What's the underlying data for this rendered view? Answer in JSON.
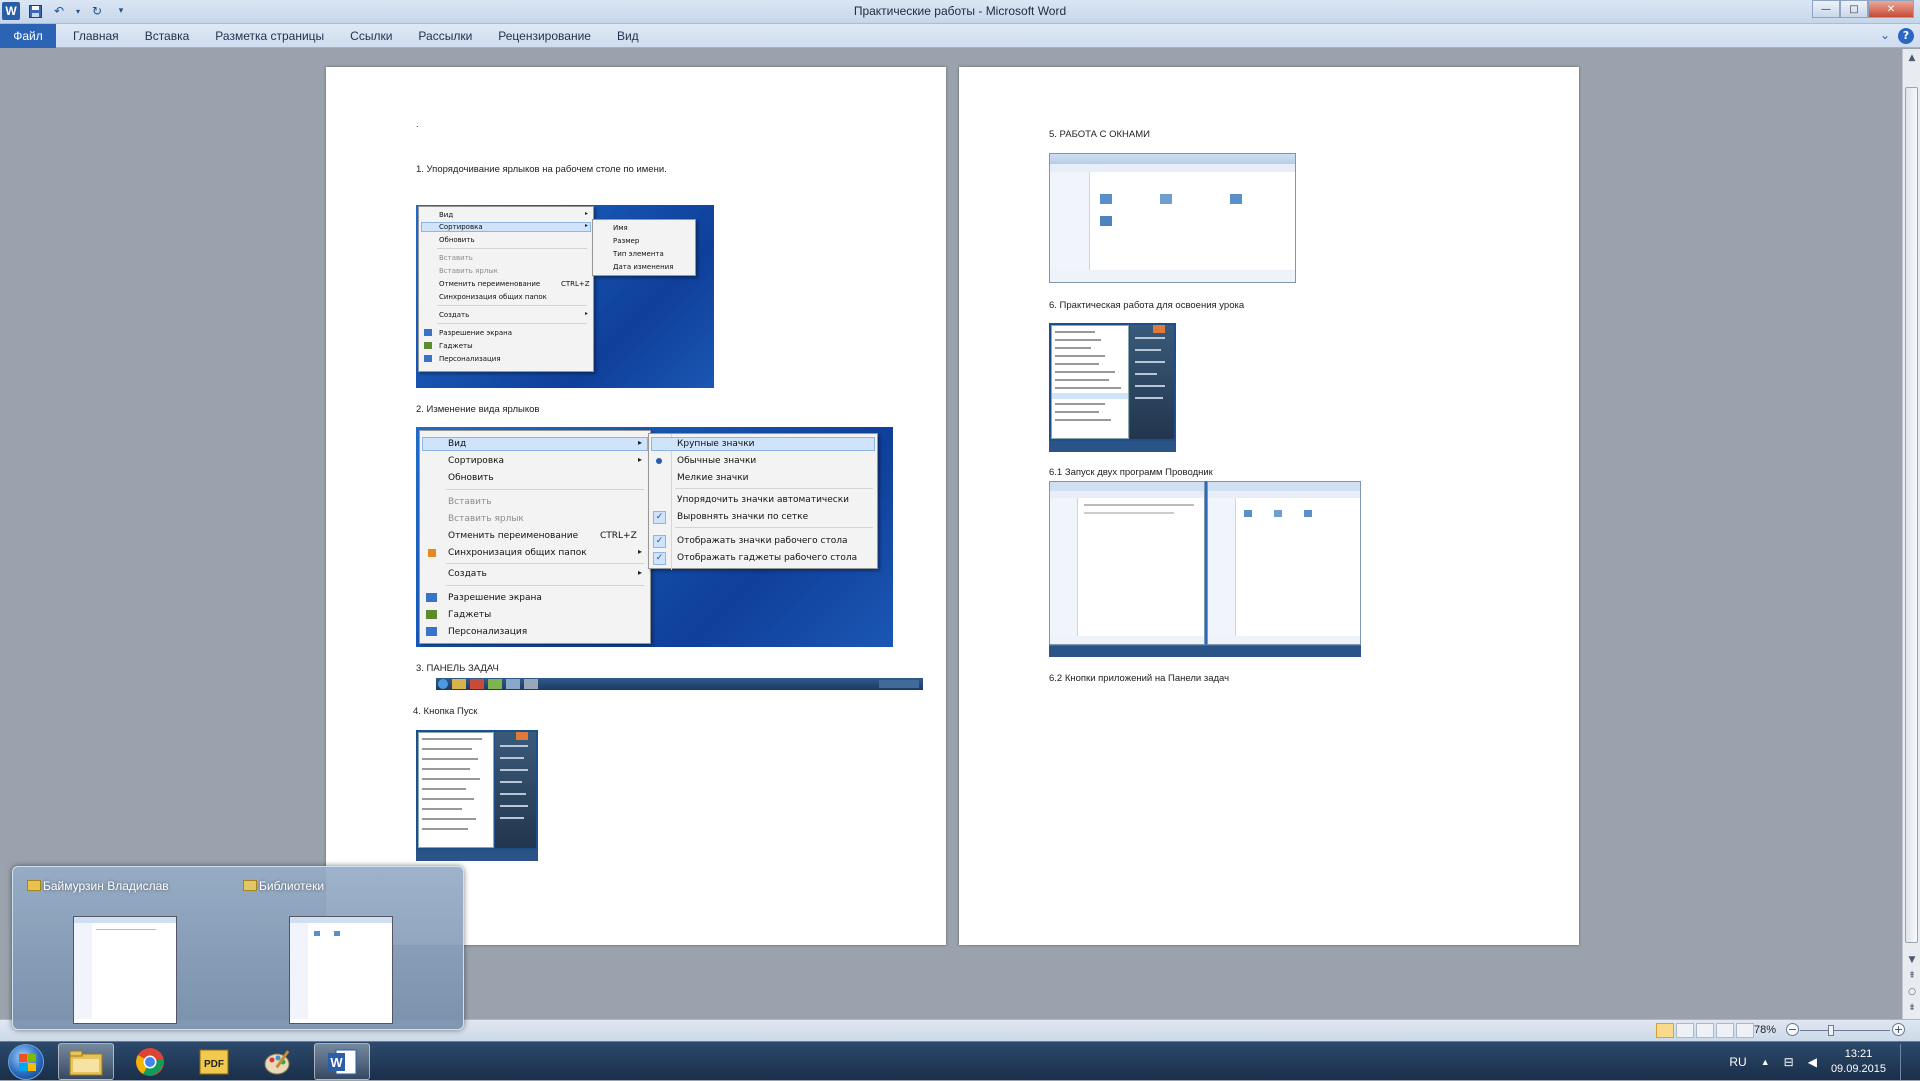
{
  "window": {
    "title": "Практические  работы  -  Microsoft Word",
    "controls": {
      "minimize": "—",
      "maximize": "□",
      "close": "✕"
    }
  },
  "ribbon": {
    "file_tab": "Файл",
    "tabs": [
      "Главная",
      "Вставка",
      "Разметка страницы",
      "Ссылки",
      "Рассылки",
      "Рецензирование",
      "Вид"
    ]
  },
  "page1": {
    "dot": ".",
    "item1": "1.   Упорядочивание  ярлыков на рабочем столе по имени.",
    "item2": "2.   Изменение вида ярлыков",
    "item3": "3.   ПАНЕЛЬ ЗАДАЧ",
    "item4": "4. Кнопка Пуск",
    "shot1": {
      "menu": [
        "Вид",
        "Сортировка",
        "Обновить",
        "Вставить",
        "Вставить ярлык",
        "Отменить переименование",
        "Синхронизация общих папок",
        "Создать",
        "Разрешение экрана",
        "Гаджеты",
        "Персонализация"
      ],
      "shortcut": "CTRL+Z",
      "submenu": [
        "Имя",
        "Размер",
        "Тип элемента",
        "Дата изменения"
      ]
    },
    "shot2": {
      "menu": [
        "Вид",
        "Сортировка",
        "Обновить",
        "Вставить",
        "Вставить ярлык",
        "Отменить переименование",
        "Синхронизация общих папок",
        "Создать",
        "Разрешение экрана",
        "Гаджеты",
        "Персонализация"
      ],
      "shortcut": "CTRL+Z",
      "submenu": [
        "Крупные значки",
        "Обычные значки",
        "Мелкие значки",
        "Упорядочить значки автоматически",
        "Выровнять значки по сетке",
        "Отображать значки рабочего стола",
        "Отображать гаджеты  рабочего стола"
      ]
    }
  },
  "page2": {
    "item5": "5. РАБОТА  С ОКНАМИ",
    "item6": "6. Практическая  работа для освоения урока",
    "item61": "6.1 Запуск двух программ Проводник",
    "item62": "6.2 Кнопки приложений на Панели задач"
  },
  "statusbar": {
    "zoom": "78%",
    "zoom_level_percent": 78
  },
  "preview": {
    "items": [
      "Баймурзин Владислав",
      "Библиотеки"
    ]
  },
  "taskbar": {
    "language": "RU",
    "time": "13:21",
    "date": "09.09.2015",
    "apps": [
      "explorer",
      "chrome",
      "pdf",
      "paint",
      "word"
    ]
  }
}
